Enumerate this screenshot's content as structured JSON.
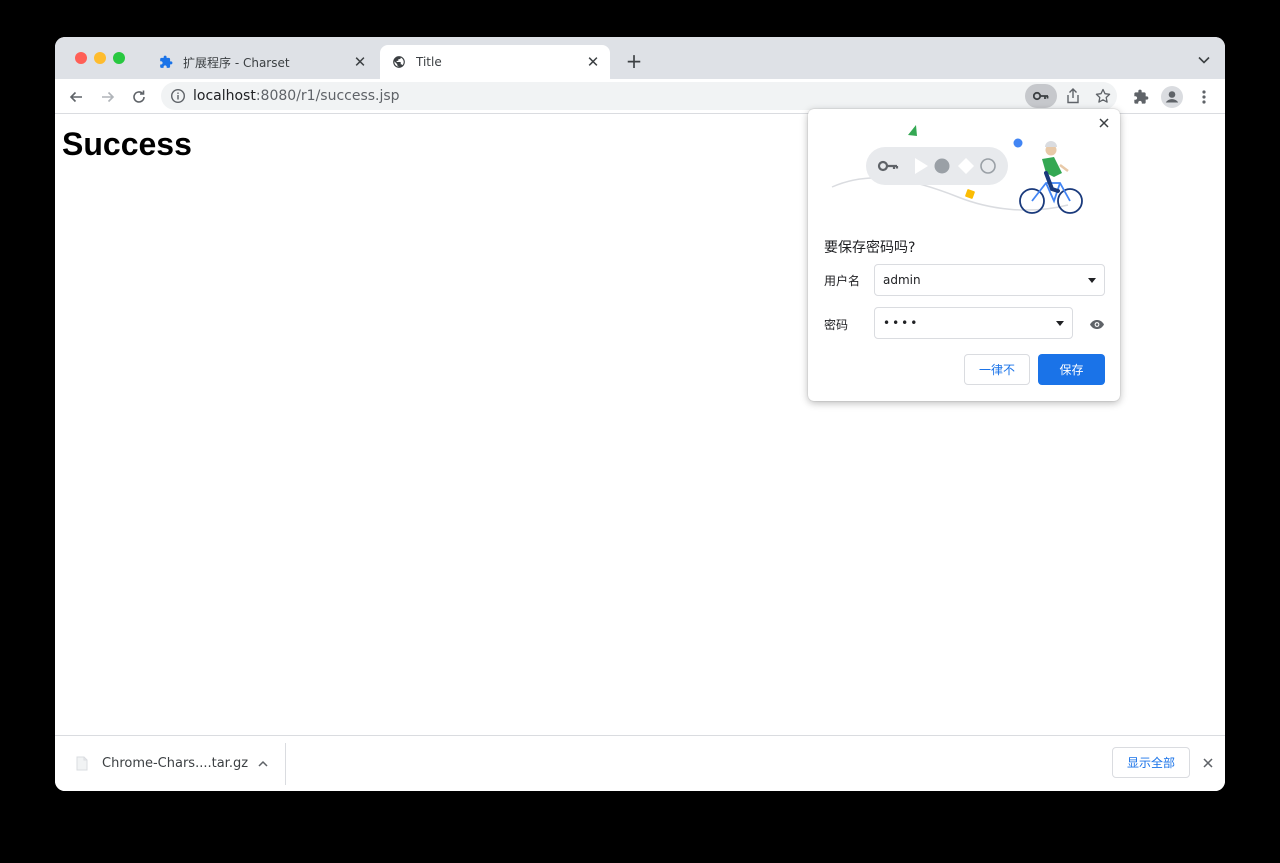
{
  "window": {
    "traffic_lights": [
      "close",
      "minimize",
      "zoom"
    ]
  },
  "tabs": [
    {
      "title": "扩展程序 - Charset",
      "icon": "puzzle-icon",
      "active": false
    },
    {
      "title": "Title",
      "icon": "globe-icon",
      "active": true
    }
  ],
  "toolbar": {
    "url_host": "localhost",
    "url_rest": ":8080/r1/success.jsp"
  },
  "page": {
    "heading": "Success"
  },
  "password_bubble": {
    "title": "要保存密码吗?",
    "username_label": "用户名",
    "username_value": "admin",
    "password_label": "密码",
    "password_value": "••••",
    "never_button": "一律不",
    "save_button": "保存"
  },
  "download_shelf": {
    "file_name": "Chrome-Chars....tar.gz",
    "show_all_button": "显示全部"
  },
  "colors": {
    "accent": "#1a73e8",
    "tabstrip": "#dee1e6",
    "omnibox": "#f1f3f4"
  }
}
